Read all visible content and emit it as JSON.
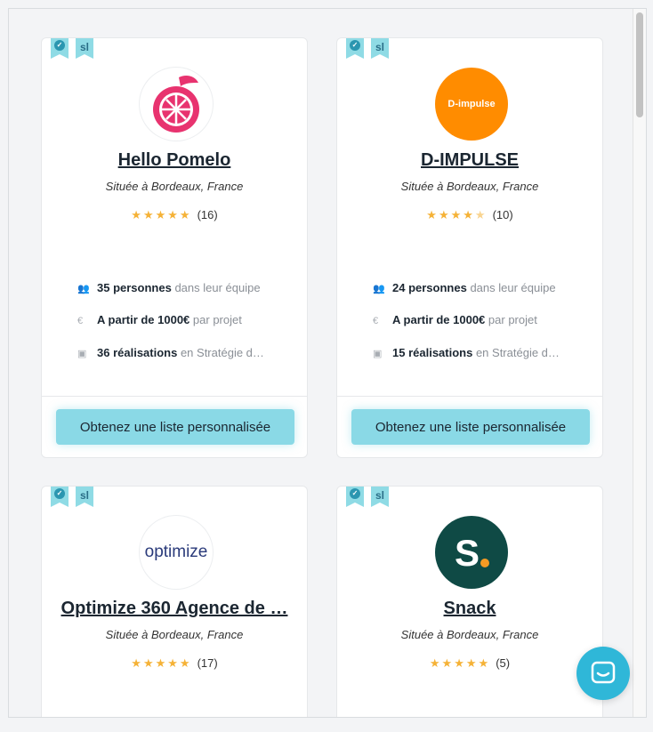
{
  "common": {
    "badge_sl": "sl",
    "location": "Située à Bordeaux, France",
    "team_suffix": "dans leur équipe",
    "price_suffix": "par projet",
    "cta_label": "Obtenez une liste personnalisée"
  },
  "cards": [
    {
      "name": "Hello Pomelo",
      "rating": 5,
      "reviews": "(16)",
      "team": "35 personnes",
      "price": "A partir de 1000€",
      "projects": "36 réalisations",
      "projects_suffix": "en Stratégie d…",
      "logo": "pomelo-logo"
    },
    {
      "name": "D-IMPULSE",
      "rating": 4.5,
      "reviews": "(10)",
      "team": "24 personnes",
      "price": "A partir de 1000€",
      "projects": "15 réalisations",
      "projects_suffix": "en Stratégie d…",
      "logo_text": "D-impulse",
      "brand_color": "#ff8c00"
    },
    {
      "name": "Optimize 360 Agence de …",
      "rating": 5,
      "reviews": "(17)",
      "logo_text": "optimize"
    },
    {
      "name": "Snack",
      "rating": 5,
      "reviews": "(5)",
      "logo_text": "S.",
      "brand_color": "#0f4a45"
    }
  ],
  "icons": [
    "verified-icon",
    "people-icon",
    "euro-icon",
    "gallery-icon",
    "chat-icon"
  ],
  "colors": {
    "accent": "#8ad9e6",
    "star": "#f5b237",
    "chat": "#2fb7d8"
  }
}
